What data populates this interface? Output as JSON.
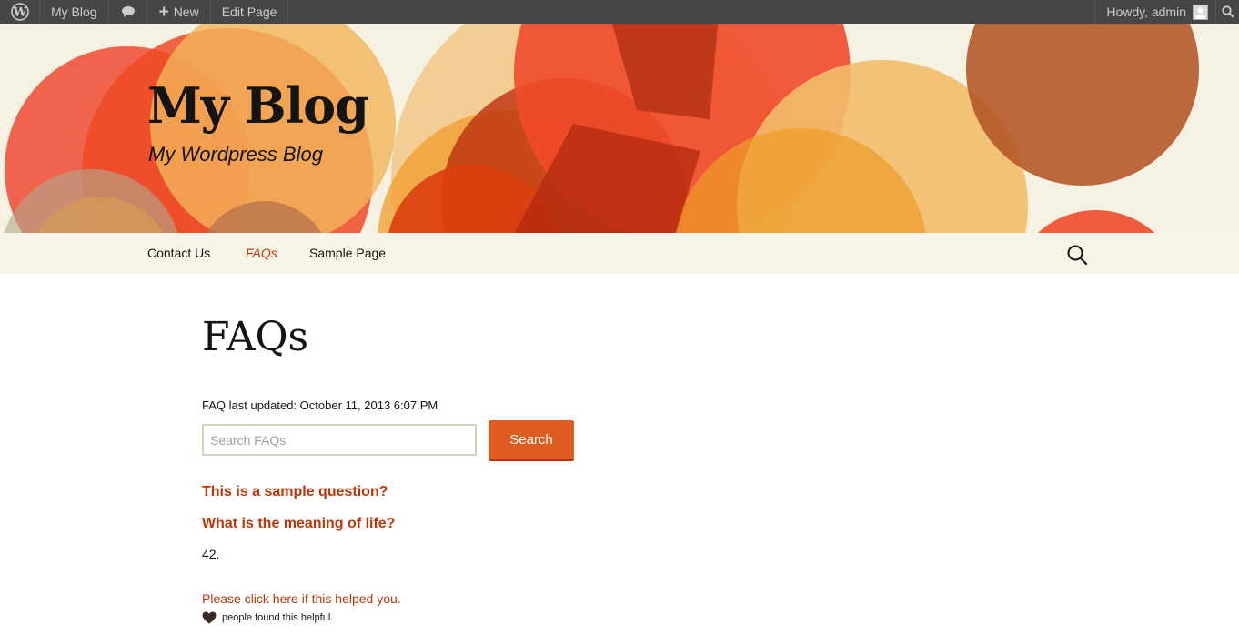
{
  "admin_bar": {
    "site_name": "My Blog",
    "new_label": "New",
    "edit_label": "Edit Page",
    "howdy": "Howdy, admin"
  },
  "site": {
    "title": "My Blog",
    "description": "My Wordpress Blog"
  },
  "nav": {
    "items": [
      {
        "label": "Contact Us",
        "active": false
      },
      {
        "label": "FAQs",
        "active": true
      },
      {
        "label": "Sample Page",
        "active": false
      }
    ]
  },
  "page": {
    "title": "FAQs",
    "updated": "FAQ last updated: October 11, 2013 6:07 PM",
    "search_placeholder": "Search FAQs",
    "search_button": "Search",
    "questions": [
      "This is a sample question?",
      "What is the meaning of life?"
    ],
    "answer": "42.",
    "helpful_link": "Please click here if this helped you.",
    "helpful_count_text": "people found this helpful."
  },
  "colors": {
    "accent": "#bc360a",
    "button": "#e05d22",
    "admin_bar": "#464646",
    "nav_bg": "#f7f5e7"
  },
  "icons": {
    "wp": "wordpress-logo-icon",
    "comments": "comment-bubble-icon",
    "search": "search-icon",
    "heart": "heart-icon"
  }
}
